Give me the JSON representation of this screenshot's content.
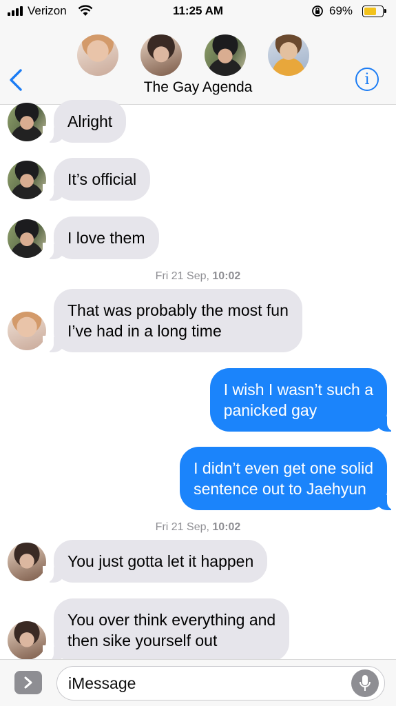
{
  "status_bar": {
    "carrier": "Verizon",
    "time": "11:25 AM",
    "battery_percent_text": "69%",
    "battery_level": 0.69,
    "battery_color": "#f2c21b"
  },
  "header": {
    "title": "The Gay Agenda",
    "back_icon": "chevron-left-icon",
    "info_icon": "info-icon",
    "info_glyph": "i",
    "accent_color": "#1b7cf4"
  },
  "messages": [
    {
      "direction": "incoming",
      "text": "Alright"
    },
    {
      "direction": "incoming",
      "text": "It’s official"
    },
    {
      "direction": "incoming",
      "text": "I love them"
    },
    {
      "direction": "incoming",
      "lines": [
        "That was probably the most fun",
        "I’ve had in a long time"
      ]
    },
    {
      "direction": "outgoing",
      "lines": [
        "I wish I wasn’t such a",
        "panicked gay"
      ]
    },
    {
      "direction": "outgoing",
      "lines": [
        "I didn’t even get one solid",
        "sentence out to Jaehyun"
      ]
    },
    {
      "direction": "incoming",
      "text": "You just gotta let it happen"
    },
    {
      "direction": "incoming",
      "lines": [
        "You over think everything and",
        "then sike yourself out"
      ]
    }
  ],
  "timestamps": [
    {
      "day": "Fri 21 Sep,",
      "time": "10:02"
    },
    {
      "day": "Fri 21 Sep,",
      "time": "10:02"
    }
  ],
  "input_bar": {
    "placeholder": "iMessage",
    "apps_icon": "chevron-right-icon",
    "mic_icon": "microphone-icon"
  },
  "colors": {
    "outgoing_bubble": "#1b84fb",
    "incoming_bubble": "#e6e5eb",
    "timestamp_text": "#8e8e93"
  }
}
